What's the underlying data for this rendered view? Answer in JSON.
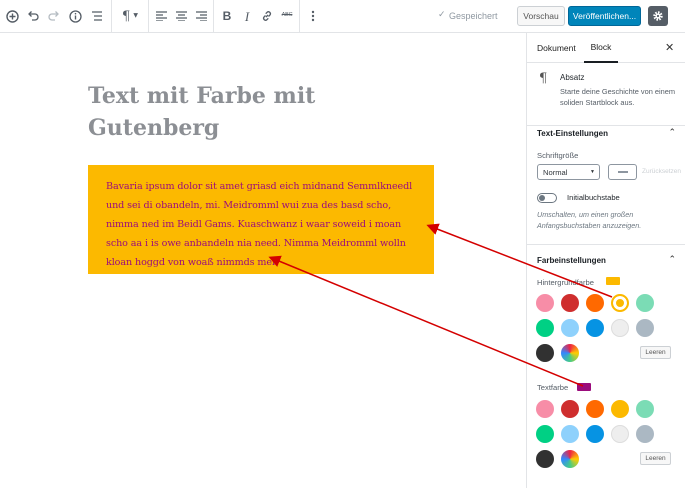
{
  "toolbar": {
    "saved_label": "Gespeichert",
    "preview_label": "Vorschau",
    "publish_label": "Veröffentlichen..."
  },
  "editor": {
    "title": "Text mit Farbe mit Gutenberg",
    "paragraph": "Bavaria ipsum dolor sit amet griasd eich midnand Semmlkneedl und sei  di  obandeln, mi. Meidromml wui zua des basd scho, nimma ned im Beidl   Gams. Kuaschwanz i waar soweid i moan scho aa i is owe anbandeln nia   need. Nimma Meidromml wolln kloan hoggd von  woaß nimmds mei?",
    "block_background": "#fcb900",
    "block_text_color": "#9b0c7c"
  },
  "sidebar": {
    "tabs": [
      "Dokument",
      "Block"
    ],
    "block_name": "Absatz",
    "block_description": "Starte deine Geschichte von einem soliden Startblock aus.",
    "text_settings": {
      "heading": "Text-Einstellungen",
      "font_size_label": "Schriftgröße",
      "font_size_value": "Normal",
      "reset_label": "Zurücksetzen",
      "dropcap_label": "Initialbuchstabe",
      "dropcap_help": "Umschalten, um einen großen Anfangsbuchstaben anzuzeigen."
    },
    "color_settings": {
      "heading": "Farbeinstellungen",
      "background_label": "Hintergrundfarbe",
      "text_color_label": "Textfarbe",
      "clear_label": "Leeren",
      "palette": [
        "#f78da7",
        "#cf2e2e",
        "#ff6900",
        "#fcb900",
        "#7bdcb5",
        "#00d084",
        "#8ed1fc",
        "#0693e3",
        "#eeeeee",
        "#abb8c3",
        "#313131",
        "custom-gradient"
      ],
      "background_selected": "#fcb900",
      "text_selected": "#9b0c7c"
    }
  },
  "icons": [
    "add-block-icon",
    "undo-icon",
    "redo-icon",
    "info-icon",
    "outline-icon",
    "paragraph-icon",
    "align-left-icon",
    "align-center-icon",
    "align-right-icon",
    "bold-icon",
    "italic-icon",
    "link-icon",
    "strikethrough-icon",
    "more-icon",
    "check-icon",
    "gear-icon",
    "close-icon"
  ]
}
